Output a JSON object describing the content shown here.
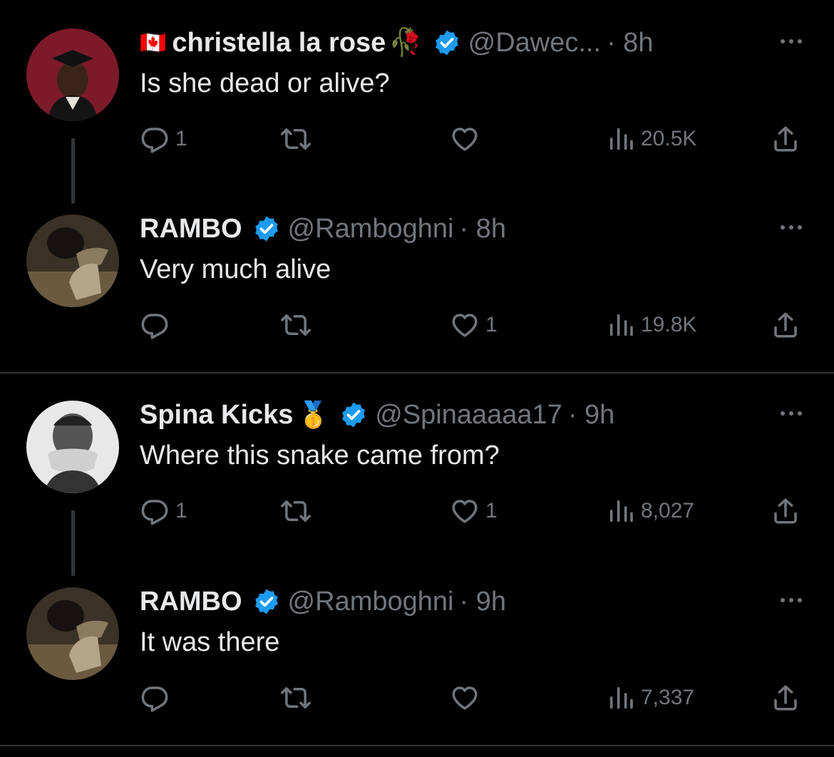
{
  "tweets": [
    {
      "name": "christella la rose",
      "leading_emoji": "🇨🇦",
      "trailing_emoji": "🥀",
      "handle": "@Dawec...",
      "time": "· 8h",
      "text": "Is she dead or alive?",
      "replies": "1",
      "retweets": "",
      "likes": "",
      "views": "20.5K"
    },
    {
      "name": "RAMBO",
      "handle": "@Ramboghni",
      "time": "· 8h",
      "text": "Very much alive",
      "replies": "",
      "retweets": "",
      "likes": "1",
      "views": "19.8K"
    },
    {
      "name": "Spina Kicks",
      "trailing_emoji": "🥇",
      "handle": "@Spinaaaaa17",
      "time": "· 9h",
      "text": "Where this snake came from?",
      "replies": "1",
      "retweets": "",
      "likes": "1",
      "views": "8,027"
    },
    {
      "name": "RAMBO",
      "handle": "@Ramboghni",
      "time": "· 9h",
      "text": "It was there",
      "replies": "",
      "retweets": "",
      "likes": "",
      "views": "7,337"
    }
  ],
  "colors": {
    "background": "#000000",
    "text_primary": "#e7e9ea",
    "text_secondary": "#71767b",
    "verified_blue": "#1d9bf0",
    "divider": "#2f3336"
  },
  "icons": [
    "reply-icon",
    "retweet-icon",
    "like-icon",
    "views-icon",
    "share-icon",
    "verified-badge-icon",
    "more-icon"
  ]
}
